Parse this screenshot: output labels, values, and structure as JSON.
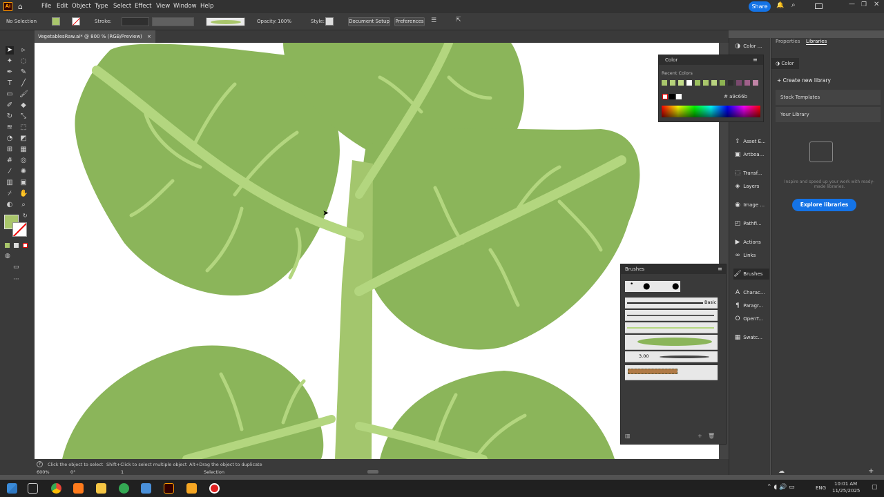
{
  "app": {
    "logo": "Ai"
  },
  "menu": [
    "File",
    "Edit",
    "Object",
    "Type",
    "Select",
    "Effect",
    "View",
    "Window",
    "Help"
  ],
  "share_label": "Share",
  "control": {
    "selection": "No Selection",
    "stroke_label": "Stroke:",
    "opacity_label": "Opacity:",
    "opacity_value": "100%",
    "style_label": "Style:",
    "document_setup": "Document Setup",
    "preferences": "Preferences",
    "fill_color": "#a9c66b"
  },
  "document_tab": {
    "title": "VegetablesRaw.ai* @ 800 % (RGB/Preview)",
    "close": "×"
  },
  "status": {
    "hint1": "Click the object to select",
    "hint2": "Shift+Click to select multiple object",
    "hint3": "Alt+Drag the object to duplicate",
    "zoom": "600%",
    "angle": "0°",
    "page": "1",
    "mode": "Selection"
  },
  "dock": [
    {
      "label": "Color ...",
      "icon": "color-icon"
    },
    {
      "label": "Asset E...",
      "icon": "asset-export-icon"
    },
    {
      "label": "Artboa...",
      "icon": "artboards-icon"
    },
    {
      "label": "Transf...",
      "icon": "transform-icon"
    },
    {
      "label": "Layers",
      "icon": "layers-icon"
    },
    {
      "label": "Image ...",
      "icon": "image-trace-icon"
    },
    {
      "label": "Pathfi...",
      "icon": "pathfinder-icon"
    },
    {
      "label": "Actions",
      "icon": "actions-icon"
    },
    {
      "label": "Links",
      "icon": "links-icon"
    },
    {
      "label": "Brushes",
      "icon": "brushes-icon"
    },
    {
      "label": "Charac...",
      "icon": "character-icon"
    },
    {
      "label": "Paragr...",
      "icon": "paragraph-icon"
    },
    {
      "label": "OpenT...",
      "icon": "opentype-icon"
    },
    {
      "label": "Swatc...",
      "icon": "swatches-icon"
    }
  ],
  "color_dock_tab": "Color",
  "library": {
    "tabs": [
      "Properties",
      "Libraries"
    ],
    "create": "Create new library",
    "stock": "Stock Templates",
    "your": "Your Library",
    "hint": "Inspire and speed up your work with ready-made libraries.",
    "explore": "Explore libraries"
  },
  "color_panel": {
    "title": "Color",
    "recent_label": "Recent Colors",
    "hex": "a9c66b",
    "recent": [
      "#a8c66c",
      "#b5d17a",
      "#c3dc8a",
      "#ffffff",
      "#9bbf5e",
      "#a9c66b",
      "#b8d37f",
      "#8db352",
      "#2e2e2e",
      "#7a4a6e",
      "#a0608a",
      "#c084a6"
    ]
  },
  "brush_panel": {
    "title": "Brushes",
    "basic": "Basic",
    "size": "3.00"
  },
  "clock": {
    "time": "10:01 AM",
    "date": "11/25/2025"
  },
  "lang": "ENG",
  "leaf_color": "#8bb55a",
  "vein_color": "#b3d67f",
  "stem_color": "#a3c66d"
}
